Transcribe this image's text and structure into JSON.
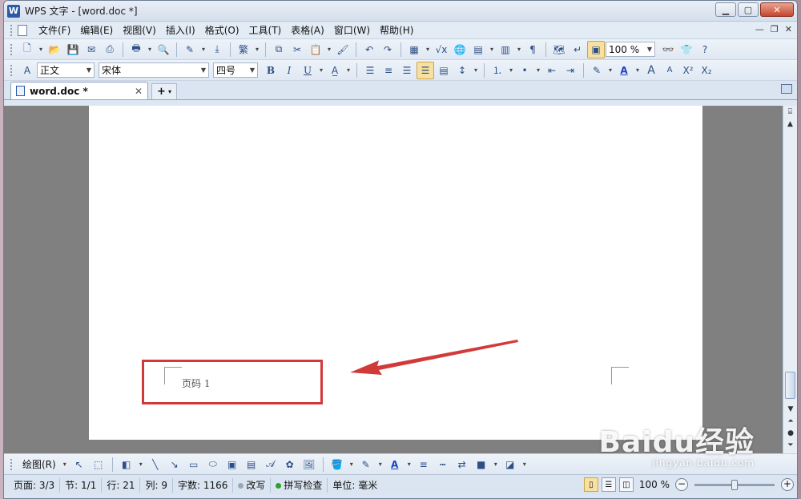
{
  "window": {
    "title": "WPS 文字 - [word.doc *]",
    "app_icon_letter": "W"
  },
  "menubar": {
    "items": [
      "文件(F)",
      "编辑(E)",
      "视图(V)",
      "插入(I)",
      "格式(O)",
      "工具(T)",
      "表格(A)",
      "窗口(W)",
      "帮助(H)"
    ]
  },
  "toolbar1": {
    "zoom": "100 %"
  },
  "toolbar2": {
    "style": "正文",
    "font": "宋体",
    "size": "四号"
  },
  "tabs": {
    "active_label": "word.doc *"
  },
  "document": {
    "page_number_text": "页码  1"
  },
  "drawbar": {
    "label": "绘图(R)"
  },
  "statusbar": {
    "page": "页面: 3/3",
    "section": "节: 1/1",
    "row": "行: 21",
    "col": "列: 9",
    "wordcount": "字数: 1166",
    "overwrite": "改写",
    "spellcheck": "拼写检查",
    "unit": "单位: 毫米",
    "zoom": "100 %",
    "zoom_level_percent": 50
  },
  "watermark": {
    "main": "Baidu经验",
    "sub": "jingyan.baidu.com"
  },
  "colors": {
    "annotation_red": "#d23a3a",
    "spell_green": "#2aa32a"
  }
}
